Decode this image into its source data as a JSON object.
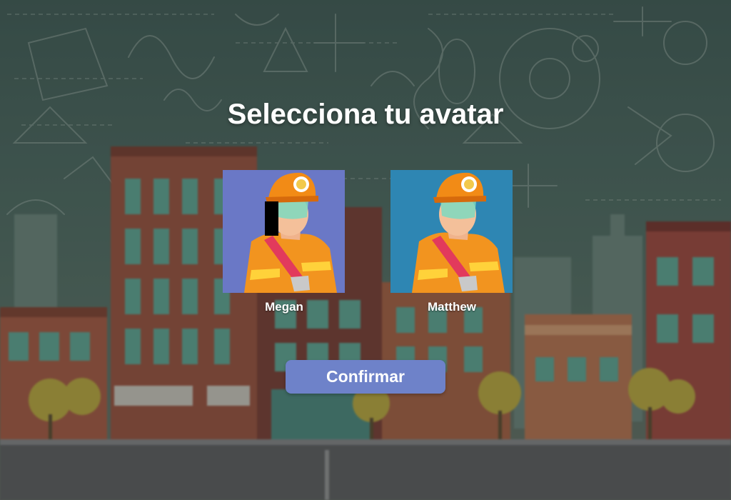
{
  "screen": {
    "title": "Selecciona tu avatar"
  },
  "avatars": [
    {
      "name": "Megan",
      "background_color": "#6a78c6",
      "selected": false
    },
    {
      "name": "Matthew",
      "background_color": "#2e86b3",
      "selected": false
    }
  ],
  "actions": {
    "confirm_label": "Confirmar"
  },
  "colors": {
    "button": "#6e82c9",
    "title_text": "#ffffff",
    "chalkboard": "#3e5c55"
  }
}
